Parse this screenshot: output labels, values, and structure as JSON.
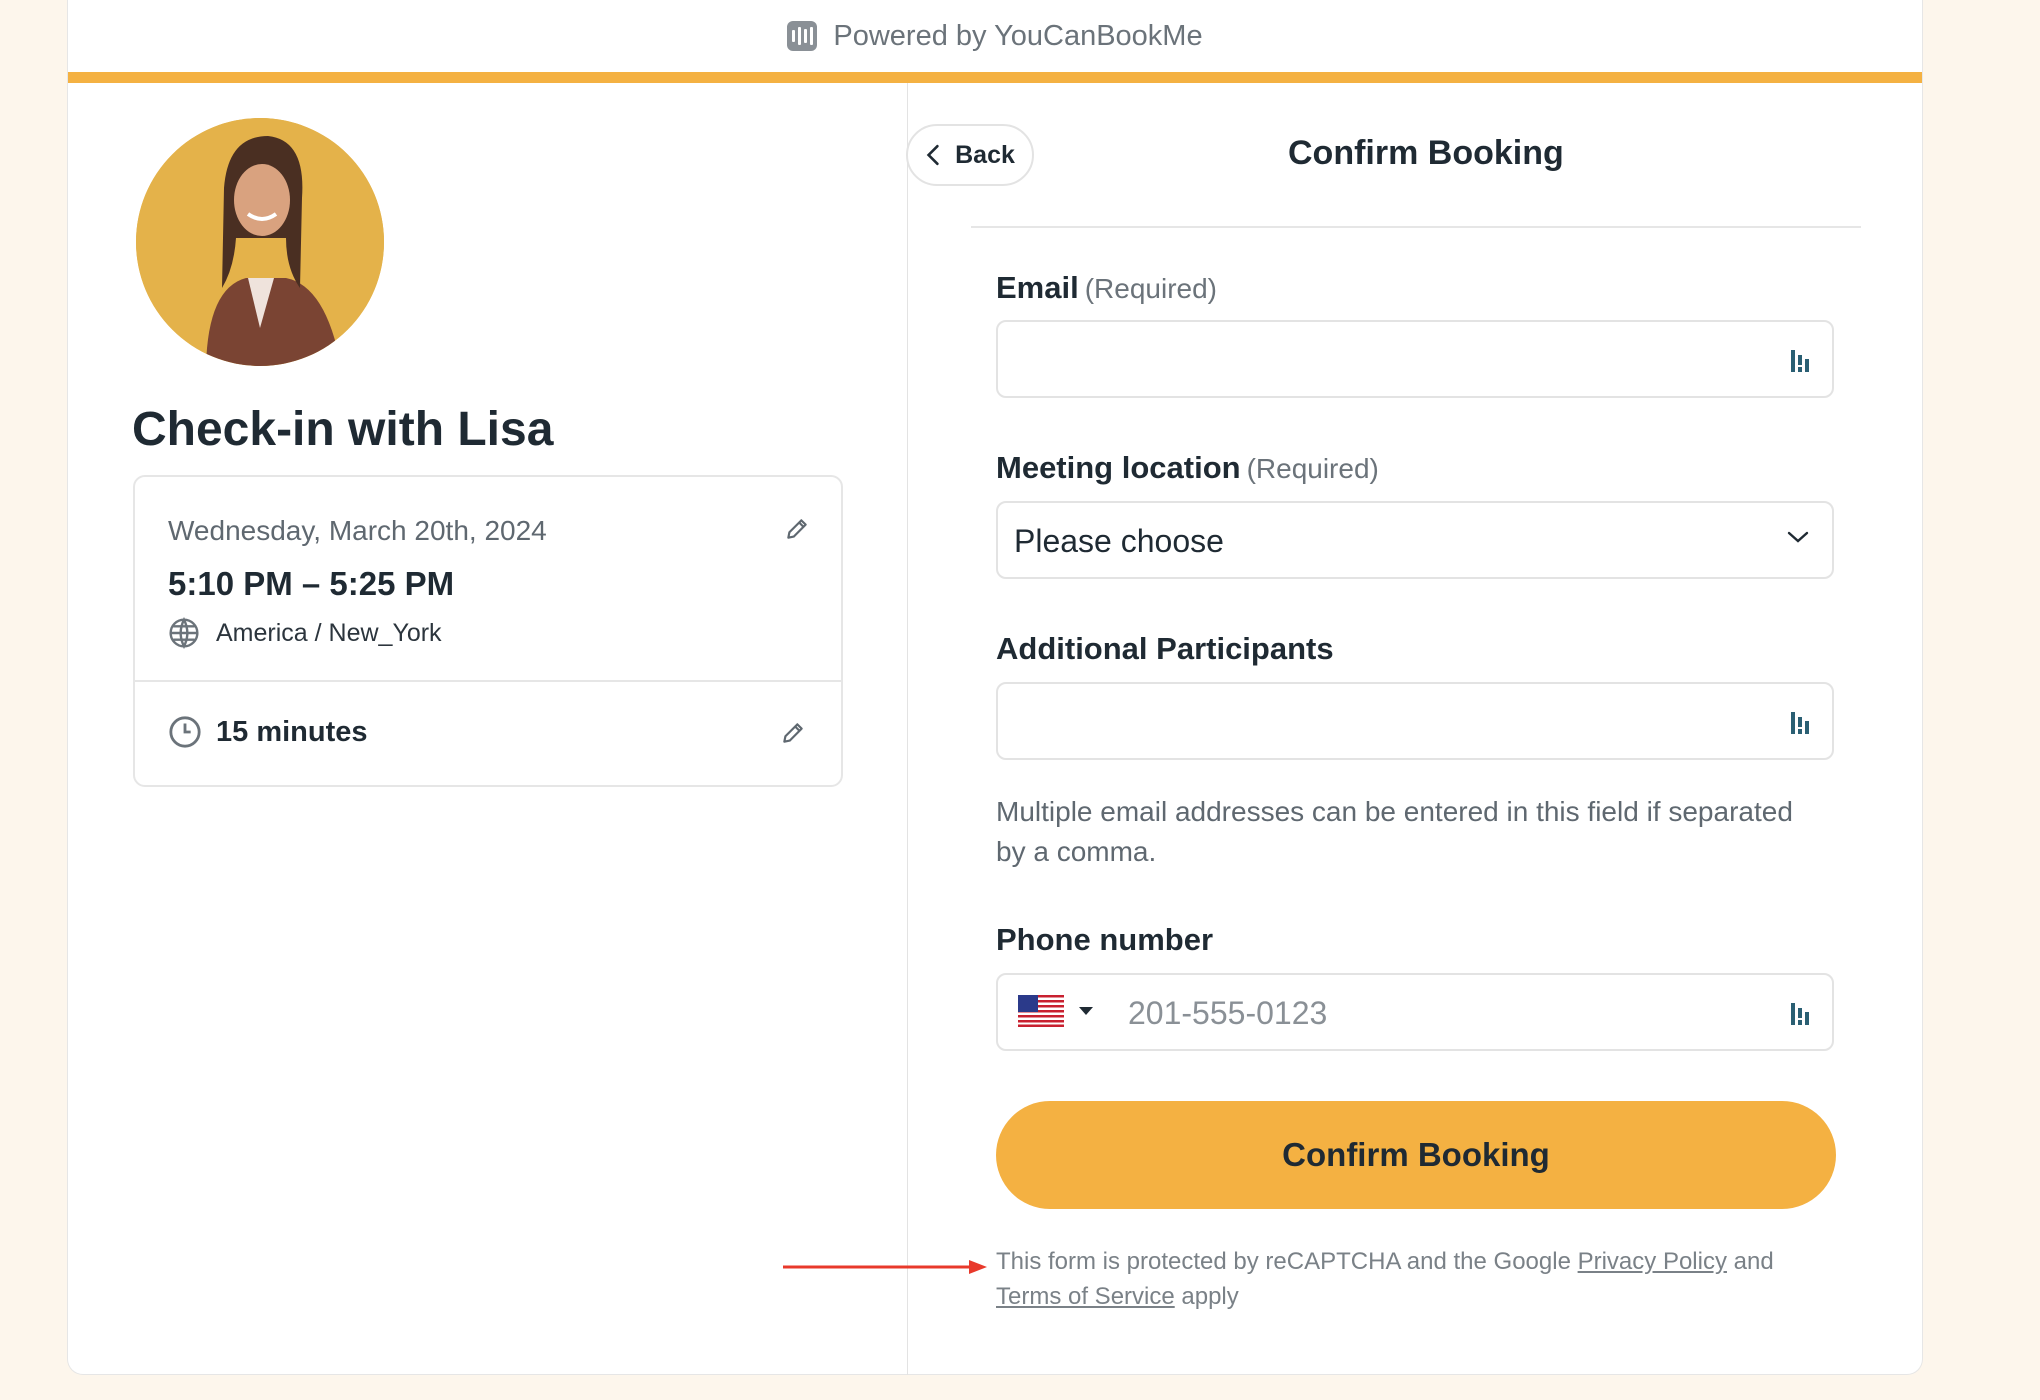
{
  "header": {
    "powered_by": "Powered by YouCanBookMe"
  },
  "colors": {
    "accent": "#f4b142",
    "background": "#fdf6ec",
    "text": "#1f2a33",
    "annotation_arrow": "#e8392b"
  },
  "event": {
    "title": "Check-in with Lisa",
    "date": "Wednesday, March 20th, 2024",
    "time": "5:10 PM – 5:25 PM",
    "timezone": "America / New_York",
    "duration": "15 minutes"
  },
  "form": {
    "back_label": "Back",
    "title": "Confirm Booking",
    "email": {
      "label": "Email",
      "required": "(Required)",
      "value": ""
    },
    "meeting_location": {
      "label": "Meeting location",
      "required": "(Required)",
      "selected": "Please choose"
    },
    "participants": {
      "label": "Additional Participants",
      "value": "",
      "help": "Multiple email addresses can be entered in this field if separated by a comma."
    },
    "phone": {
      "label": "Phone number",
      "placeholder": "201-555-0123",
      "country_icon": "us-flag-icon"
    },
    "submit_label": "Confirm Booking"
  },
  "recaptcha": {
    "prefix": "This form is protected by reCAPTCHA and the Google",
    "privacy_link": "Privacy Policy",
    "and": "and",
    "terms_link": "Terms of Service",
    "suffix": "apply"
  }
}
